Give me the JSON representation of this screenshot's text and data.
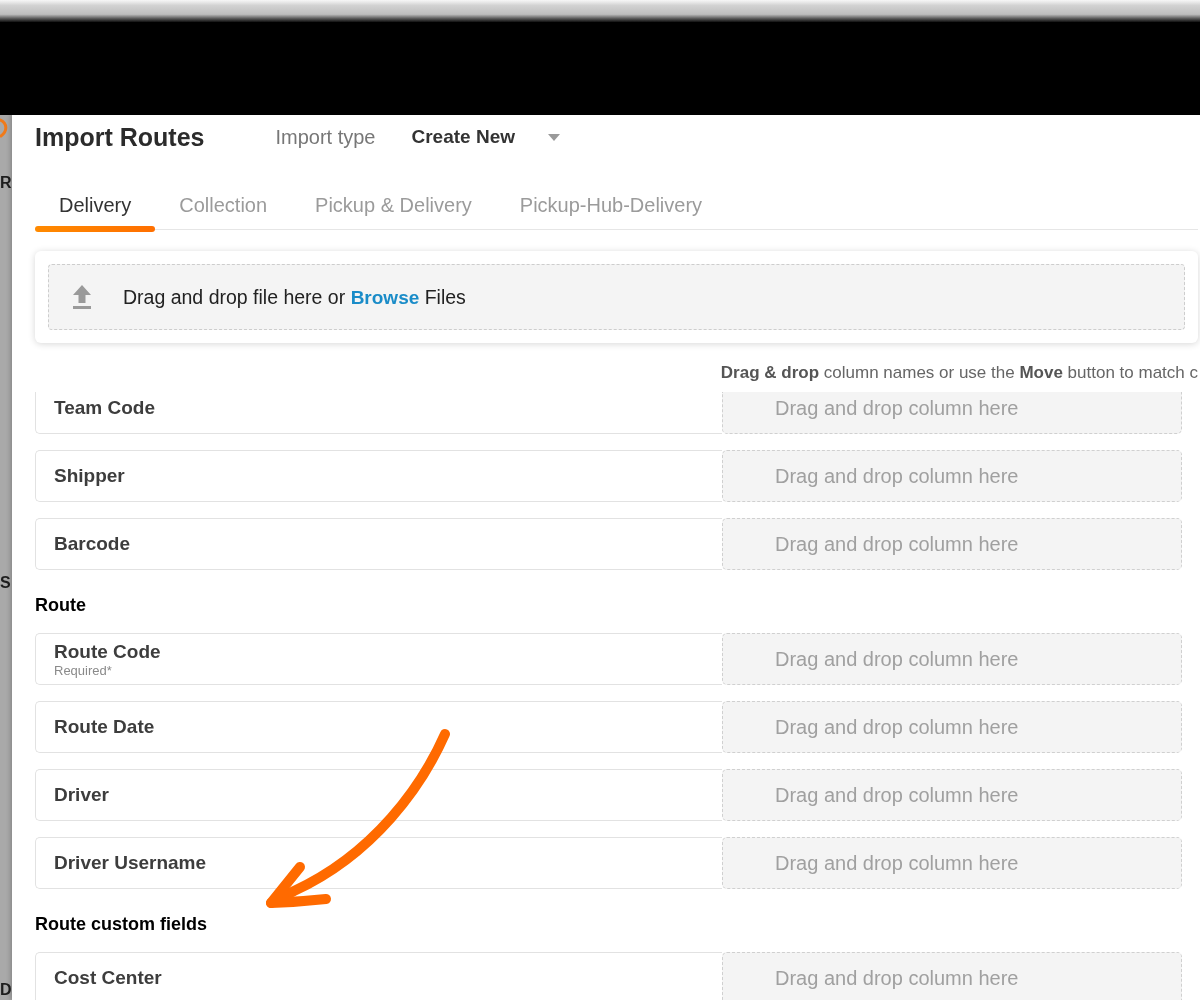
{
  "background_page": {
    "texts": [
      "R",
      "S",
      "D"
    ]
  },
  "dialog": {
    "title": "Import Routes",
    "import_type_label": "Import type",
    "import_type_value": "Create New"
  },
  "tabs": [
    {
      "label": "Delivery",
      "selected": true
    },
    {
      "label": "Collection",
      "selected": false
    },
    {
      "label": "Pickup & Delivery",
      "selected": false
    },
    {
      "label": "Pickup-Hub-Delivery",
      "selected": false
    }
  ],
  "upload": {
    "prompt_before": "Drag and drop file here or",
    "link": "Browse",
    "prompt_after": "Files"
  },
  "hint": "**Drag & drop** column names or use the **Move** button to match c",
  "field_groups": [
    {
      "fields": [
        {
          "label": "Team Code",
          "placeholder": "Drag and drop column here"
        },
        {
          "label": "Shipper",
          "placeholder": "Drag and drop column here"
        },
        {
          "label": "Barcode",
          "placeholder": "Drag and drop column here"
        }
      ]
    },
    {
      "title": "Route",
      "fields": [
        {
          "label": "Route Code",
          "note": "Required*",
          "placeholder": "Drag and drop column here"
        },
        {
          "label": "Route Date",
          "placeholder": "Drag and drop column here"
        },
        {
          "label": "Driver",
          "placeholder": "Drag and drop column here"
        },
        {
          "label": "Driver Username",
          "placeholder": "Drag and drop column here"
        }
      ]
    },
    {
      "title": "Route custom fields",
      "fields": [
        {
          "label": "Cost Center",
          "placeholder": "Drag and drop column here"
        }
      ]
    }
  ]
}
